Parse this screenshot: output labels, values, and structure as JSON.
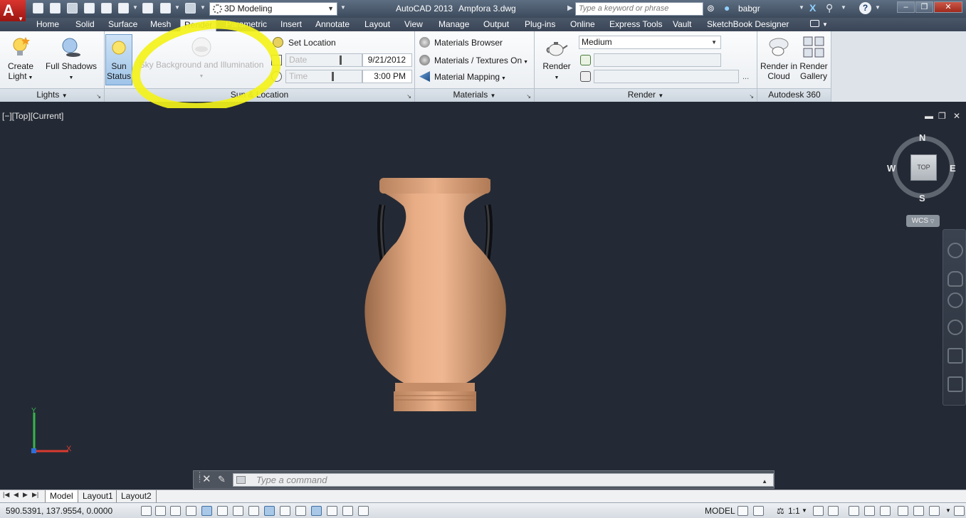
{
  "titlebar": {
    "workspace": "3D Modeling",
    "app_title": "AutoCAD 2013",
    "file_name": "Ampfora 3.dwg",
    "search_placeholder": "Type a keyword or phrase",
    "user": "babgr"
  },
  "tabs": [
    "Home",
    "Solid",
    "Surface",
    "Mesh",
    "Render",
    "Parametric",
    "Insert",
    "Annotate",
    "Layout",
    "View",
    "Manage",
    "Output",
    "Plug-ins",
    "Online",
    "Express Tools",
    "Vault",
    "SketchBook Designer"
  ],
  "active_tab": "Render",
  "ribbon": {
    "lights": {
      "create_light_1": "Create",
      "create_light_2": "Light",
      "full_shadows": "Full Shadows",
      "panel_title": "Lights"
    },
    "sun": {
      "sun_status_1": "Sun",
      "sun_status_2": "Status",
      "sky_bg": "Sky Background and Illumination",
      "set_location": "Set Location",
      "date_label": "Date",
      "date_value": "9/21/2012",
      "time_label": "Time",
      "time_value": "3:00 PM",
      "panel_title": "Sun & Location"
    },
    "materials": {
      "browser": "Materials Browser",
      "textures": "Materials / Textures On",
      "mapping": "Material Mapping",
      "panel_title": "Materials"
    },
    "render": {
      "render_btn": "Render",
      "quality": "Medium",
      "more": "...",
      "panel_title": "Render"
    },
    "autodesk360": {
      "cloud_1": "Render in",
      "cloud_2": "Cloud",
      "gallery_1": "Render",
      "gallery_2": "Gallery",
      "panel_title": "Autodesk 360"
    }
  },
  "viewport": {
    "label": "[−][Top][Current]",
    "viewcube": {
      "face": "TOP",
      "n": "N",
      "s": "S",
      "e": "E",
      "w": "W"
    },
    "wcs": "WCS",
    "ucs_x": "X",
    "ucs_y": "Y"
  },
  "command_line": {
    "placeholder": "Type a command"
  },
  "layout_tabs": [
    "Model",
    "Layout1",
    "Layout2"
  ],
  "status": {
    "coords": "590.5391, 137.9554, 0.0000",
    "model": "MODEL",
    "scale": "1:1"
  }
}
